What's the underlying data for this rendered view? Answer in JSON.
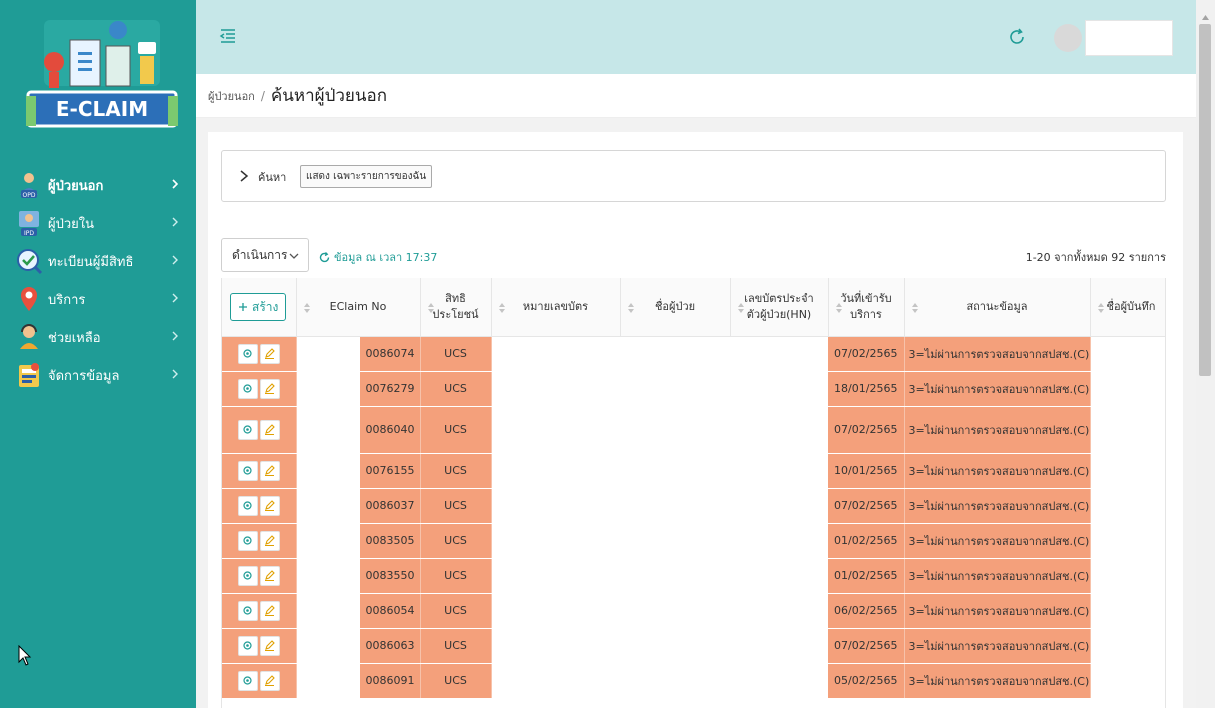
{
  "brand": {
    "logo_text": "E-CLAIM"
  },
  "sidebar": {
    "items": [
      {
        "label": "ผู้ป่วยนอก",
        "icon": "opd-patient-icon"
      },
      {
        "label": "ผู้ป่วยใน",
        "icon": "ipd-patient-icon"
      },
      {
        "label": "ทะเบียนผู้มีสิทธิ",
        "icon": "check-badge-icon"
      },
      {
        "label": "บริการ",
        "icon": "location-pin-icon"
      },
      {
        "label": "ช่วยเหลือ",
        "icon": "support-agent-icon"
      },
      {
        "label": "จัดการข้อมูล",
        "icon": "data-manage-icon"
      }
    ]
  },
  "breadcrumb": {
    "parent": "ผู้ป่วยนอก",
    "separator": "/",
    "current": "ค้นหาผู้ป่วยนอก"
  },
  "search": {
    "label": "ค้นหา",
    "mine_button": "แสดง เฉพาะรายการของฉัน"
  },
  "toolbar": {
    "action_label": "ดำเนินการ",
    "refresh_text": "ข้อมูล ณ เวลา 17:37",
    "pager_text": "1-20 จากทั้งหมด 92 รายการ"
  },
  "table": {
    "create_label": "สร้าง",
    "headers": {
      "eclaim": "EClaim No",
      "right": [
        "สิทธิ",
        "ประโยชน์"
      ],
      "card": "หมายเลขบัตร",
      "name": "ชื่อผู้ป่วย",
      "hn": [
        "เลขบัตรประจำ",
        "ตัวผู้ป่วย(HN)"
      ],
      "date": [
        "วันที่เข้ารับ",
        "บริการ"
      ],
      "status": "สถานะข้อมูล",
      "recorder": "ชื่อผู้บันทึก"
    },
    "rows": [
      {
        "eclaim": "0086074",
        "right": "UCS",
        "date": "07/02/2565",
        "status": "3=ไม่ผ่านการตรวจสอบจากสปสช.(C)"
      },
      {
        "eclaim": "0076279",
        "right": "UCS",
        "date": "18/01/2565",
        "status": "3=ไม่ผ่านการตรวจสอบจากสปสช.(C)"
      },
      {
        "eclaim": "0086040",
        "right": "UCS",
        "date": "07/02/2565",
        "status": "3=ไม่ผ่านการตรวจสอบจากสปสช.(C)"
      },
      {
        "eclaim": "0076155",
        "right": "UCS",
        "date": "10/01/2565",
        "status": "3=ไม่ผ่านการตรวจสอบจากสปสช.(C)"
      },
      {
        "eclaim": "0086037",
        "right": "UCS",
        "date": "07/02/2565",
        "status": "3=ไม่ผ่านการตรวจสอบจากสปสช.(C)"
      },
      {
        "eclaim": "0083505",
        "right": "UCS",
        "date": "01/02/2565",
        "status": "3=ไม่ผ่านการตรวจสอบจากสปสช.(C)"
      },
      {
        "eclaim": "0083550",
        "right": "UCS",
        "date": "01/02/2565",
        "status": "3=ไม่ผ่านการตรวจสอบจากสปสช.(C)"
      },
      {
        "eclaim": "0086054",
        "right": "UCS",
        "date": "06/02/2565",
        "status": "3=ไม่ผ่านการตรวจสอบจากสปสช.(C)"
      },
      {
        "eclaim": "0086063",
        "right": "UCS",
        "date": "07/02/2565",
        "status": "3=ไม่ผ่านการตรวจสอบจากสปสช.(C)"
      },
      {
        "eclaim": "0086091",
        "right": "UCS",
        "date": "05/02/2565",
        "status": "3=ไม่ผ่านการตรวจสอบจากสปสช.(C)"
      }
    ]
  },
  "colors": {
    "sidebar": "#1f9c96",
    "topbar": "#c6e7e8",
    "row_highlight": "#f4a07b",
    "accent": "#1f9c96"
  }
}
